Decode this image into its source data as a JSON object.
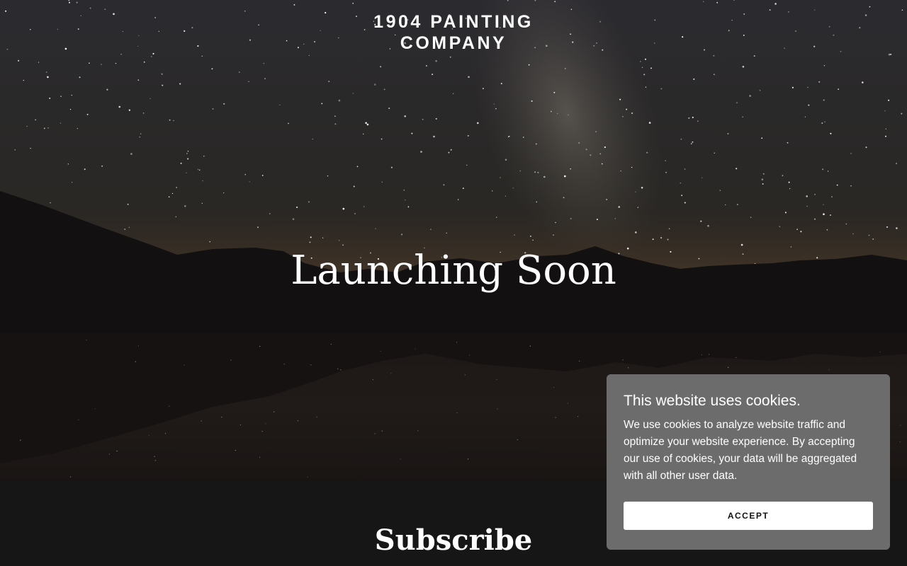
{
  "header": {
    "title_line1": "1904 PAINTING",
    "title_line2": "COMPANY"
  },
  "hero": {
    "headline": "Launching Soon",
    "background": "starry-night-mountain-lake-photo"
  },
  "subscribe": {
    "title": "Subscribe"
  },
  "cookie_banner": {
    "title": "This website uses cookies.",
    "body": "We use cookies to analyze website traffic and optimize your website experience. By accepting our use of cookies, your data will be aggregated with all other user data.",
    "accept_label": "ACCEPT",
    "background_color": "#6c6c6c"
  }
}
